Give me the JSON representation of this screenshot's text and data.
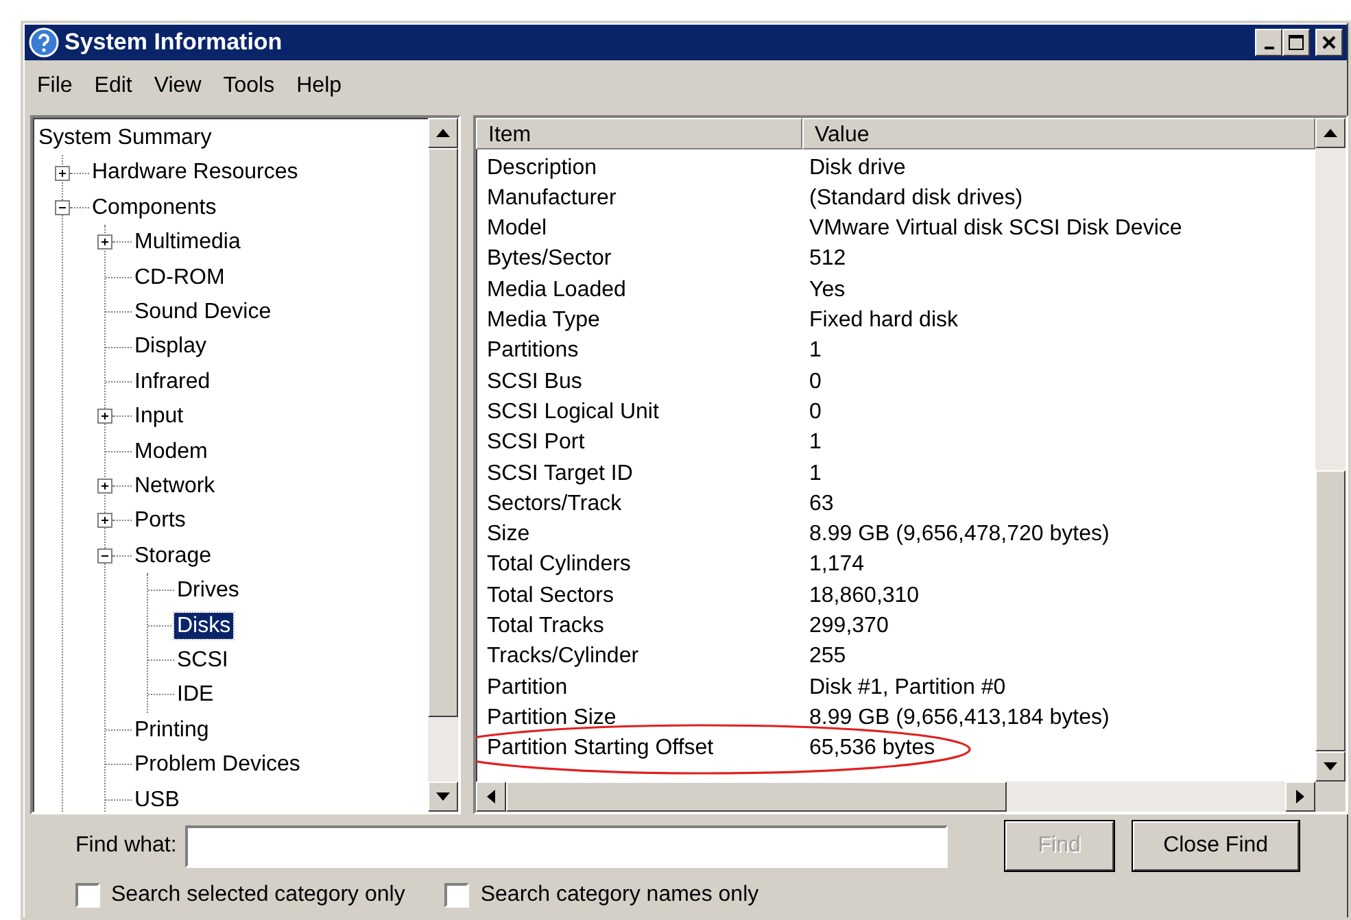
{
  "window": {
    "title": "System Information"
  },
  "menu": [
    "File",
    "Edit",
    "View",
    "Tools",
    "Help"
  ],
  "tree": [
    {
      "label": "System Summary",
      "selected": false,
      "children": [
        {
          "label": "Hardware Resources",
          "selected": false,
          "expanded": false
        },
        {
          "label": "Components",
          "selected": false,
          "expanded": true,
          "children": [
            {
              "label": "Multimedia",
              "selected": false,
              "expanded": false
            },
            {
              "label": "CD-ROM",
              "selected": false
            },
            {
              "label": "Sound Device",
              "selected": false
            },
            {
              "label": "Display",
              "selected": false
            },
            {
              "label": "Infrared",
              "selected": false
            },
            {
              "label": "Input",
              "selected": false,
              "expanded": false
            },
            {
              "label": "Modem",
              "selected": false
            },
            {
              "label": "Network",
              "selected": false,
              "expanded": false
            },
            {
              "label": "Ports",
              "selected": false,
              "expanded": false
            },
            {
              "label": "Storage",
              "selected": false,
              "expanded": true,
              "children": [
                {
                  "label": "Drives",
                  "selected": false
                },
                {
                  "label": "Disks",
                  "selected": true
                },
                {
                  "label": "SCSI",
                  "selected": false
                },
                {
                  "label": "IDE",
                  "selected": false
                }
              ]
            },
            {
              "label": "Printing",
              "selected": false
            },
            {
              "label": "Problem Devices",
              "selected": false
            },
            {
              "label": "USB",
              "selected": false
            }
          ]
        }
      ]
    }
  ],
  "table": {
    "columns": [
      "Item",
      "Value"
    ],
    "rows": [
      {
        "item": "Description",
        "value": "Disk drive",
        "circled": false
      },
      {
        "item": "Manufacturer",
        "value": "(Standard disk drives)",
        "circled": false
      },
      {
        "item": "Model",
        "value": "VMware Virtual disk SCSI Disk Device",
        "circled": false
      },
      {
        "item": "Bytes/Sector",
        "value": "512",
        "circled": false
      },
      {
        "item": "Media Loaded",
        "value": "Yes",
        "circled": false
      },
      {
        "item": "Media Type",
        "value": "Fixed hard disk",
        "circled": false
      },
      {
        "item": "Partitions",
        "value": "1",
        "circled": false
      },
      {
        "item": "SCSI Bus",
        "value": "0",
        "circled": false
      },
      {
        "item": "SCSI Logical Unit",
        "value": "0",
        "circled": false
      },
      {
        "item": "SCSI Port",
        "value": "1",
        "circled": false
      },
      {
        "item": "SCSI Target ID",
        "value": "1",
        "circled": false
      },
      {
        "item": "Sectors/Track",
        "value": "63",
        "circled": false
      },
      {
        "item": "Size",
        "value": "8.99 GB (9,656,478,720 bytes)",
        "circled": false
      },
      {
        "item": "Total Cylinders",
        "value": "1,174",
        "circled": false
      },
      {
        "item": "Total Sectors",
        "value": "18,860,310",
        "circled": false
      },
      {
        "item": "Total Tracks",
        "value": "299,370",
        "circled": false
      },
      {
        "item": "Tracks/Cylinder",
        "value": "255",
        "circled": false
      },
      {
        "item": "Partition",
        "value": "Disk #1, Partition #0",
        "circled": false
      },
      {
        "item": "Partition Size",
        "value": "8.99 GB (9,656,413,184 bytes)",
        "circled": false
      },
      {
        "item": "Partition Starting Offset",
        "value": "65,536 bytes",
        "circled": true
      }
    ]
  },
  "find": {
    "label": "Find what:",
    "buttons": [
      {
        "label": "Find",
        "disabled": true
      },
      {
        "label": "Close Find",
        "disabled": false
      }
    ],
    "options": [
      {
        "label": "Search selected category only",
        "checked": false
      },
      {
        "label": "Search category names only",
        "checked": false
      }
    ]
  }
}
